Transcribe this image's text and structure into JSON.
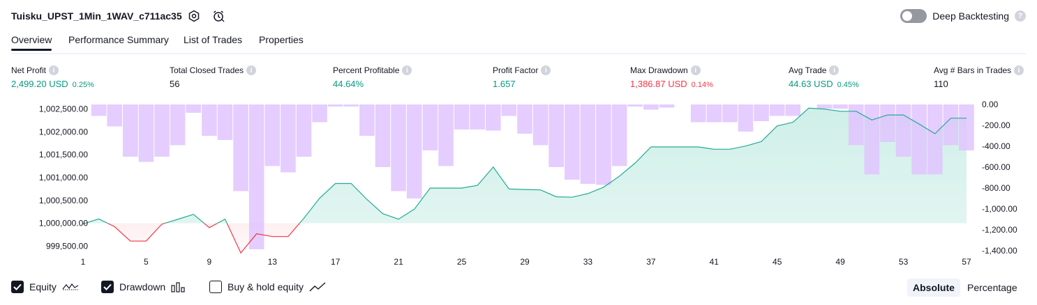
{
  "header": {
    "strategy_name": "Tuisku_UPST_1Min_1WAV_c711ac35",
    "settings_icon": "gear-icon",
    "alert_icon": "alarm-clock-icon",
    "deep_backtesting_label": "Deep Backtesting",
    "deep_backtesting_enabled": false
  },
  "tabs": [
    "Overview",
    "Performance Summary",
    "List of Trades",
    "Properties"
  ],
  "active_tab": "Overview",
  "metrics": {
    "net_profit": {
      "label": "Net Profit",
      "value": "2,499.20 USD",
      "pct": "0.25%"
    },
    "total_closed_trades": {
      "label": "Total Closed Trades",
      "value": "56"
    },
    "percent_profitable": {
      "label": "Percent Profitable",
      "value": "44.64%"
    },
    "profit_factor": {
      "label": "Profit Factor",
      "value": "1.657"
    },
    "max_drawdown": {
      "label": "Max Drawdown",
      "value": "1,386.87 USD",
      "pct": "0.14%"
    },
    "avg_trade": {
      "label": "Avg Trade",
      "value": "44.63 USD",
      "pct": "0.45%"
    },
    "avg_bars_in_trades": {
      "label": "Avg # Bars in Trades",
      "value": "110"
    }
  },
  "chart_data": {
    "type": "line",
    "x_ticks": [
      "1",
      "5",
      "9",
      "13",
      "17",
      "21",
      "25",
      "29",
      "33",
      "37",
      "41",
      "45",
      "49",
      "53",
      "57"
    ],
    "left_axis": {
      "ticks": [
        "1,002,500.00",
        "1,002,000.00",
        "1,001,500.00",
        "1,001,000.00",
        "1,000,500.00",
        "1,000,000.00",
        "999,500.00"
      ],
      "range": [
        999400,
        1002600
      ]
    },
    "right_axis": {
      "ticks": [
        "0.00",
        "-200.00",
        "-400.00",
        "-600.00",
        "-800.00",
        "-1,000.00",
        "-1,200.00",
        "-1,400.00"
      ],
      "range": [
        -1400,
        0
      ]
    },
    "colors": {
      "equity_line": "#22ab94",
      "equity_fill": "#cdeee7",
      "equity_negative": "#f23645",
      "drawdown_bar": "#e1c4ff"
    },
    "series": [
      {
        "name": "Equity",
        "x": [
          1,
          2,
          3,
          4,
          5,
          6,
          7,
          8,
          9,
          10,
          11,
          12,
          13,
          14,
          15,
          16,
          17,
          18,
          19,
          20,
          21,
          22,
          23,
          24,
          25,
          26,
          27,
          28,
          29,
          30,
          31,
          32,
          33,
          34,
          35,
          36,
          37,
          38,
          39,
          40,
          41,
          42,
          43,
          44,
          45,
          46,
          47,
          48,
          49,
          50,
          51,
          52,
          53,
          54,
          55,
          56,
          57
        ],
        "values": [
          999985,
          1000095,
          999925,
          999610,
          999610,
          999980,
          1000085,
          1000195,
          999905,
          1000090,
          999350,
          999770,
          999710,
          999710,
          1000110,
          1000550,
          1000870,
          1000870,
          1000520,
          1000210,
          1000090,
          1000310,
          1000770,
          1000770,
          1000770,
          1000830,
          1001230,
          1000750,
          1000740,
          1000730,
          1000580,
          1000570,
          1000650,
          1000790,
          1001030,
          1001320,
          1001670,
          1001670,
          1001670,
          1001670,
          1001620,
          1001620,
          1001690,
          1001790,
          1002130,
          1002210,
          1002520,
          1002500,
          1002450,
          1002450,
          1002260,
          1002370,
          1002370,
          1002170,
          1001960,
          1002300,
          1002300
        ]
      },
      {
        "name": "Drawdown",
        "x": [
          1,
          2,
          3,
          4,
          5,
          6,
          7,
          8,
          9,
          10,
          11,
          12,
          13,
          14,
          15,
          16,
          17,
          18,
          19,
          20,
          21,
          22,
          23,
          24,
          25,
          26,
          27,
          28,
          29,
          30,
          31,
          32,
          33,
          34,
          35,
          36,
          37,
          38,
          39,
          40,
          41,
          42,
          43,
          44,
          45,
          46,
          47,
          48,
          49,
          50,
          51,
          52,
          53,
          54,
          55,
          56,
          57
        ],
        "values": [
          0,
          -110,
          -210,
          -500,
          -550,
          -500,
          -390,
          -80,
          -300,
          -340,
          -830,
          -1386.87,
          -590,
          -650,
          -500,
          -170,
          -20,
          -20,
          -300,
          -600,
          -830,
          -900,
          -440,
          -590,
          -240,
          -240,
          -250,
          -110,
          -280,
          -390,
          -600,
          -720,
          -760,
          -770,
          -590,
          -20,
          -50,
          -30,
          0,
          -170,
          -170,
          -170,
          -260,
          -160,
          -110,
          -110,
          0,
          -40,
          -40,
          -390,
          -670,
          -360,
          -500,
          -670,
          -670,
          -390,
          -440
        ]
      }
    ]
  },
  "legend": {
    "equity": {
      "label": "Equity",
      "checked": true
    },
    "drawdown": {
      "label": "Drawdown",
      "checked": true
    },
    "buy_hold": {
      "label": "Buy & hold equity",
      "checked": false
    }
  },
  "view_mode": {
    "absolute": "Absolute",
    "percentage": "Percentage",
    "selected": "Absolute"
  }
}
